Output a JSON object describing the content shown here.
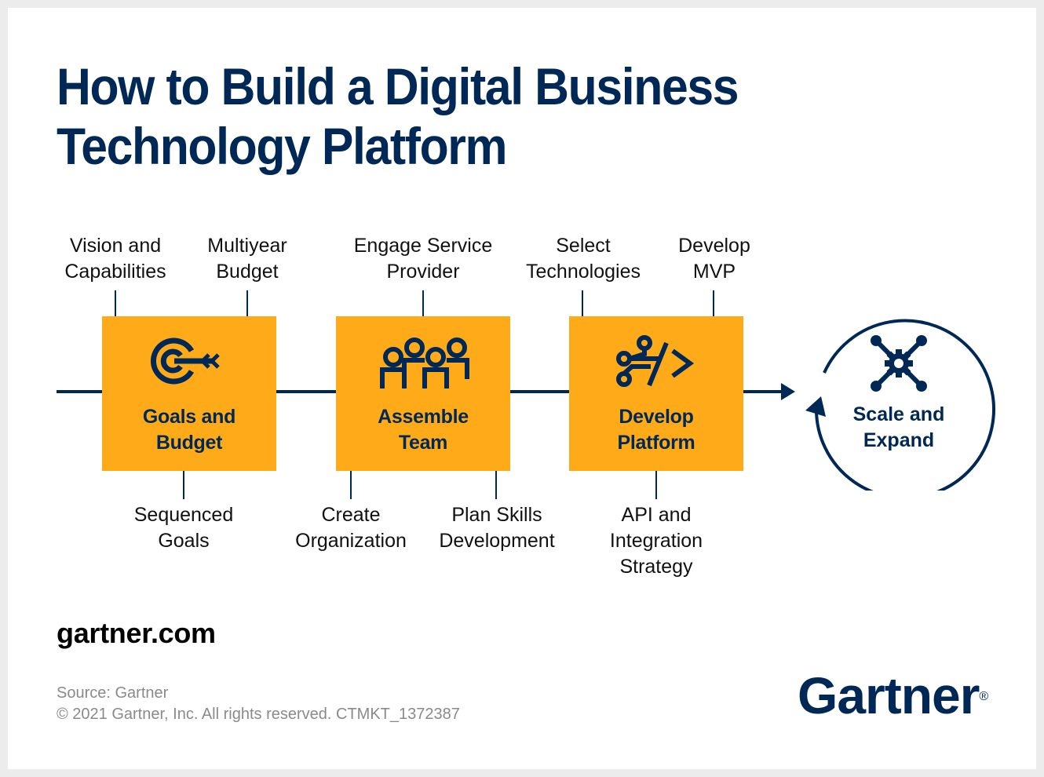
{
  "title": {
    "line1": "How to Build a Digital Business",
    "line2": "Technology Platform"
  },
  "colors": {
    "navy": "#002856",
    "orange": "#ffab19",
    "background": "#ececec",
    "card": "#ffffff",
    "footnote": "#8a8a8a"
  },
  "steps": [
    {
      "label_line1": "Goals and",
      "label_line2": "Budget",
      "icon": "target-arrow-icon",
      "above": [
        {
          "line1": "Vision and",
          "line2": "Capabilities"
        },
        {
          "line1": "Multiyear",
          "line2": "Budget"
        }
      ],
      "below": [
        {
          "line1": "Sequenced",
          "line2": "Goals"
        }
      ]
    },
    {
      "label_line1": "Assemble",
      "label_line2": "Team",
      "icon": "team-icon",
      "above": [
        {
          "line1": "Engage Service",
          "line2": "Provider"
        }
      ],
      "below": [
        {
          "line1": "Create",
          "line2": "Organization"
        },
        {
          "line1": "Plan Skills",
          "line2": "Development"
        }
      ]
    },
    {
      "label_line1": "Develop",
      "label_line2": "Platform",
      "icon": "code-branch-icon",
      "above": [
        {
          "line1": "Select",
          "line2": "Technologies"
        },
        {
          "line1": "Develop",
          "line2": "MVP"
        }
      ],
      "below": [
        {
          "line1": "API and",
          "line2": "Integration",
          "line3": "Strategy"
        }
      ]
    }
  ],
  "final_step": {
    "label_line1": "Scale and",
    "label_line2": "Expand",
    "icon": "gear-network-icon"
  },
  "footer": {
    "site": "gartner.com",
    "source": "Source: Gartner",
    "copyright": "© 2021 Gartner, Inc. All rights reserved. CTMKT_1372387",
    "logo": "Gartner",
    "logo_mark": "®"
  }
}
